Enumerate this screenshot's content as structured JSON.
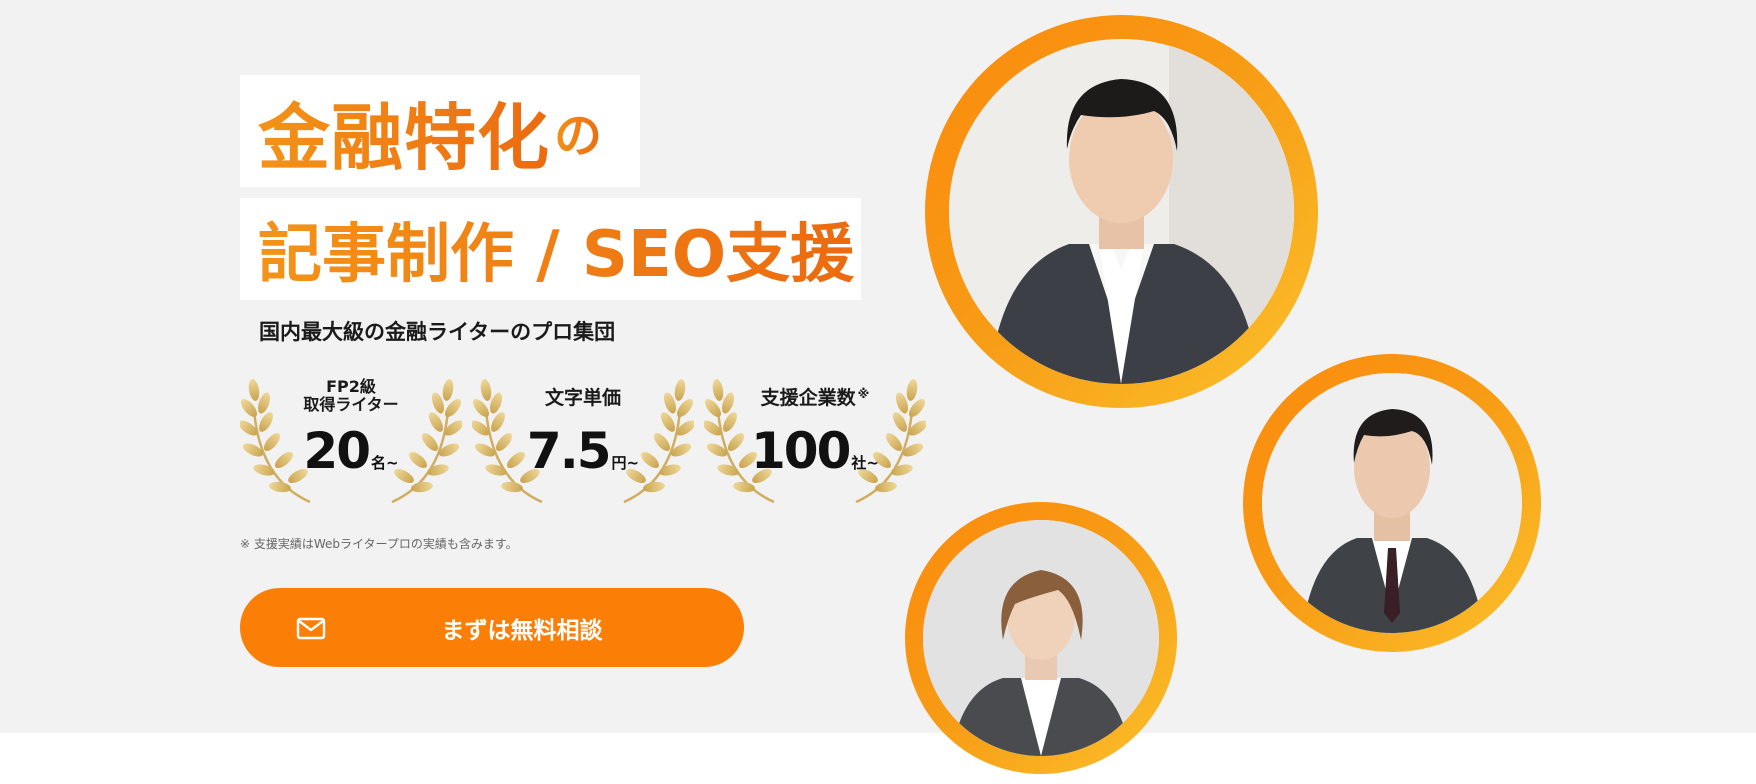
{
  "headline": {
    "line1_main": "金融特化",
    "line1_particle": "の",
    "line2": "記事制作 / SEO支援"
  },
  "tagline": "国内最大級の金融ライターのプロ集団",
  "badges": [
    {
      "label": "FP2級\n取得ライター",
      "value": "20",
      "unit": "名~",
      "note": ""
    },
    {
      "label": "文字単価",
      "value": "7.5",
      "unit": "円~",
      "note": ""
    },
    {
      "label": "支援企業数",
      "value": "100",
      "unit": "社~",
      "note": "※"
    }
  ],
  "footnote": "※ 支援実績はWebライタープロの実績も含みます。",
  "cta": {
    "label": "まずは無料相談",
    "icon": "mail-icon"
  },
  "portraits": [
    {
      "icon": "person-photo-man-1"
    },
    {
      "icon": "person-photo-man-2"
    },
    {
      "icon": "person-photo-woman"
    }
  ],
  "colors": {
    "accent": "#fb7f07",
    "headline_gradient_start": "#f39318",
    "headline_gradient_end": "#ec6a10",
    "ring_gradient_end": "#fbc12b",
    "laurel_gold": "#d8b970",
    "background": "#f2f2f2"
  }
}
